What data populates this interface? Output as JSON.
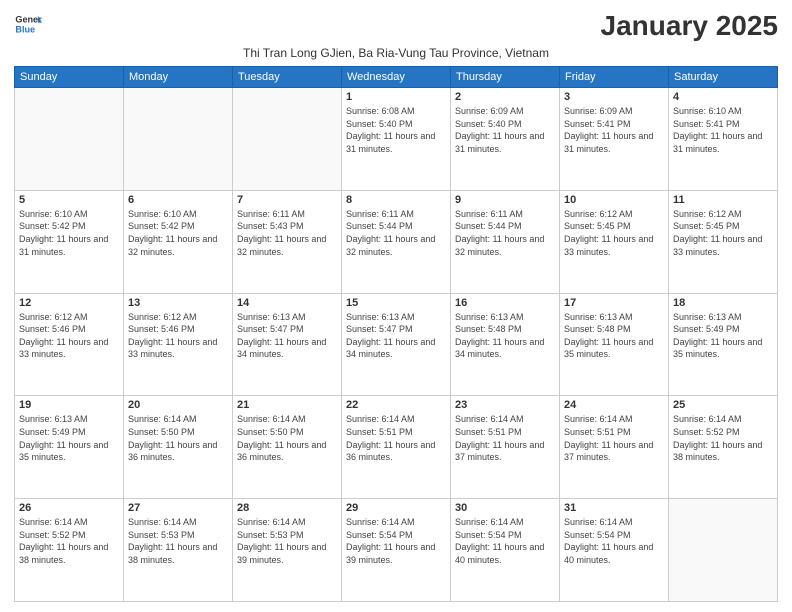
{
  "logo": {
    "text_general": "General",
    "text_blue": "Blue"
  },
  "header": {
    "month_year": "January 2025",
    "location": "Thi Tran Long GJien, Ba Ria-Vung Tau Province, Vietnam"
  },
  "weekdays": [
    "Sunday",
    "Monday",
    "Tuesday",
    "Wednesday",
    "Thursday",
    "Friday",
    "Saturday"
  ],
  "weeks": [
    [
      {
        "day": "",
        "info": ""
      },
      {
        "day": "",
        "info": ""
      },
      {
        "day": "",
        "info": ""
      },
      {
        "day": "1",
        "info": "Sunrise: 6:08 AM\nSunset: 5:40 PM\nDaylight: 11 hours and 31 minutes."
      },
      {
        "day": "2",
        "info": "Sunrise: 6:09 AM\nSunset: 5:40 PM\nDaylight: 11 hours and 31 minutes."
      },
      {
        "day": "3",
        "info": "Sunrise: 6:09 AM\nSunset: 5:41 PM\nDaylight: 11 hours and 31 minutes."
      },
      {
        "day": "4",
        "info": "Sunrise: 6:10 AM\nSunset: 5:41 PM\nDaylight: 11 hours and 31 minutes."
      }
    ],
    [
      {
        "day": "5",
        "info": "Sunrise: 6:10 AM\nSunset: 5:42 PM\nDaylight: 11 hours and 31 minutes."
      },
      {
        "day": "6",
        "info": "Sunrise: 6:10 AM\nSunset: 5:42 PM\nDaylight: 11 hours and 32 minutes."
      },
      {
        "day": "7",
        "info": "Sunrise: 6:11 AM\nSunset: 5:43 PM\nDaylight: 11 hours and 32 minutes."
      },
      {
        "day": "8",
        "info": "Sunrise: 6:11 AM\nSunset: 5:44 PM\nDaylight: 11 hours and 32 minutes."
      },
      {
        "day": "9",
        "info": "Sunrise: 6:11 AM\nSunset: 5:44 PM\nDaylight: 11 hours and 32 minutes."
      },
      {
        "day": "10",
        "info": "Sunrise: 6:12 AM\nSunset: 5:45 PM\nDaylight: 11 hours and 33 minutes."
      },
      {
        "day": "11",
        "info": "Sunrise: 6:12 AM\nSunset: 5:45 PM\nDaylight: 11 hours and 33 minutes."
      }
    ],
    [
      {
        "day": "12",
        "info": "Sunrise: 6:12 AM\nSunset: 5:46 PM\nDaylight: 11 hours and 33 minutes."
      },
      {
        "day": "13",
        "info": "Sunrise: 6:12 AM\nSunset: 5:46 PM\nDaylight: 11 hours and 33 minutes."
      },
      {
        "day": "14",
        "info": "Sunrise: 6:13 AM\nSunset: 5:47 PM\nDaylight: 11 hours and 34 minutes."
      },
      {
        "day": "15",
        "info": "Sunrise: 6:13 AM\nSunset: 5:47 PM\nDaylight: 11 hours and 34 minutes."
      },
      {
        "day": "16",
        "info": "Sunrise: 6:13 AM\nSunset: 5:48 PM\nDaylight: 11 hours and 34 minutes."
      },
      {
        "day": "17",
        "info": "Sunrise: 6:13 AM\nSunset: 5:48 PM\nDaylight: 11 hours and 35 minutes."
      },
      {
        "day": "18",
        "info": "Sunrise: 6:13 AM\nSunset: 5:49 PM\nDaylight: 11 hours and 35 minutes."
      }
    ],
    [
      {
        "day": "19",
        "info": "Sunrise: 6:13 AM\nSunset: 5:49 PM\nDaylight: 11 hours and 35 minutes."
      },
      {
        "day": "20",
        "info": "Sunrise: 6:14 AM\nSunset: 5:50 PM\nDaylight: 11 hours and 36 minutes."
      },
      {
        "day": "21",
        "info": "Sunrise: 6:14 AM\nSunset: 5:50 PM\nDaylight: 11 hours and 36 minutes."
      },
      {
        "day": "22",
        "info": "Sunrise: 6:14 AM\nSunset: 5:51 PM\nDaylight: 11 hours and 36 minutes."
      },
      {
        "day": "23",
        "info": "Sunrise: 6:14 AM\nSunset: 5:51 PM\nDaylight: 11 hours and 37 minutes."
      },
      {
        "day": "24",
        "info": "Sunrise: 6:14 AM\nSunset: 5:51 PM\nDaylight: 11 hours and 37 minutes."
      },
      {
        "day": "25",
        "info": "Sunrise: 6:14 AM\nSunset: 5:52 PM\nDaylight: 11 hours and 38 minutes."
      }
    ],
    [
      {
        "day": "26",
        "info": "Sunrise: 6:14 AM\nSunset: 5:52 PM\nDaylight: 11 hours and 38 minutes."
      },
      {
        "day": "27",
        "info": "Sunrise: 6:14 AM\nSunset: 5:53 PM\nDaylight: 11 hours and 38 minutes."
      },
      {
        "day": "28",
        "info": "Sunrise: 6:14 AM\nSunset: 5:53 PM\nDaylight: 11 hours and 39 minutes."
      },
      {
        "day": "29",
        "info": "Sunrise: 6:14 AM\nSunset: 5:54 PM\nDaylight: 11 hours and 39 minutes."
      },
      {
        "day": "30",
        "info": "Sunrise: 6:14 AM\nSunset: 5:54 PM\nDaylight: 11 hours and 40 minutes."
      },
      {
        "day": "31",
        "info": "Sunrise: 6:14 AM\nSunset: 5:54 PM\nDaylight: 11 hours and 40 minutes."
      },
      {
        "day": "",
        "info": ""
      }
    ]
  ]
}
